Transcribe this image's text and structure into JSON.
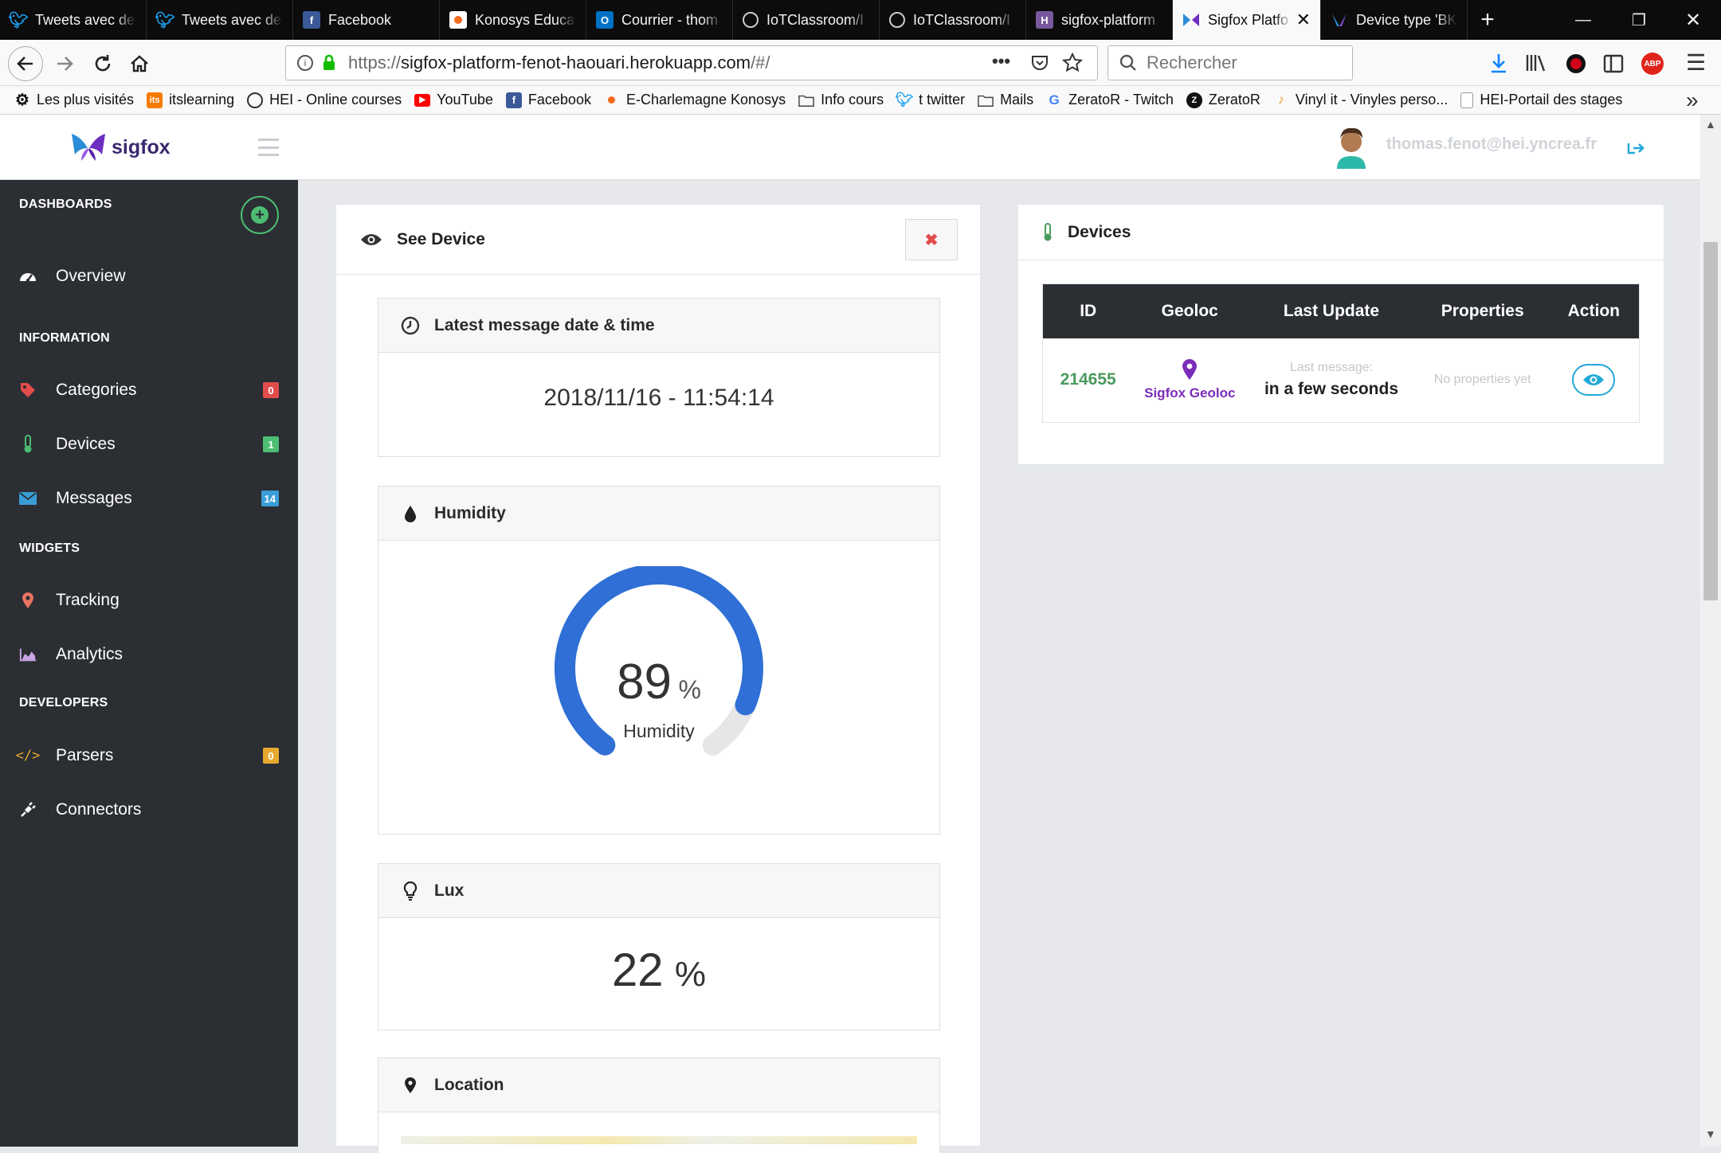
{
  "browser": {
    "tabs": [
      {
        "title": "Tweets avec de",
        "icon": "twitter-icon",
        "color": "#1da1f2"
      },
      {
        "title": "Tweets avec de",
        "icon": "twitter-icon",
        "color": "#1da1f2"
      },
      {
        "title": "Facebook",
        "icon": "facebook-icon",
        "color": "#3b5998"
      },
      {
        "title": "Konosys Educat",
        "icon": "konosys-icon",
        "color": "#f26b1d"
      },
      {
        "title": "Courrier - thom",
        "icon": "outlook-icon",
        "color": "#0072c6"
      },
      {
        "title": "IoTClassroom/I",
        "icon": "github-icon",
        "color": "#333333"
      },
      {
        "title": "IoTClassroom/I",
        "icon": "github-icon",
        "color": "#333333"
      },
      {
        "title": "sigfox-platform",
        "icon": "heroku-icon",
        "color": "#79589f"
      },
      {
        "title": "Sigfox Platfo",
        "icon": "sigfox-icon",
        "color": "#6e2dc1",
        "active": true
      },
      {
        "title": "Device type 'BK",
        "icon": "sigfox-icon",
        "color": "#6e2dc1"
      }
    ],
    "url": "https://sigfox-platform-fenot-haouari.herokuapp.com/#/",
    "url_host": "sigfox-platform-fenot-haouari.herokuapp.com",
    "url_prefix": "https://",
    "url_suffix": "/#/",
    "search_placeholder": "Rechercher",
    "bookmarks": [
      {
        "label": "Les plus visités",
        "icon": "gear-icon"
      },
      {
        "label": "itslearning",
        "icon": "itslearning-icon"
      },
      {
        "label": "HEI - Online courses",
        "icon": "globe-icon"
      },
      {
        "label": "YouTube",
        "icon": "youtube-icon"
      },
      {
        "label": "Facebook",
        "icon": "facebook-icon"
      },
      {
        "label": "E-Charlemagne Konosys",
        "icon": "konosys-icon"
      },
      {
        "label": "Info cours",
        "icon": "folder-icon"
      },
      {
        "label": "t  twitter",
        "icon": "twitter-icon"
      },
      {
        "label": "Mails",
        "icon": "folder-icon"
      },
      {
        "label": "ZeratoR - Twitch",
        "icon": "google-icon"
      },
      {
        "label": "ZeratoR",
        "icon": "zerator-icon"
      },
      {
        "label": "Vinyl it - Vinyles perso...",
        "icon": "vinyl-icon"
      },
      {
        "label": "HEI-Portail des stages",
        "icon": "page-icon"
      }
    ]
  },
  "app": {
    "brand": "sigfox",
    "user_email": "thomas.fenot@hei.yncrea.fr"
  },
  "sidebar": {
    "sections": {
      "dashboards": "DASHBOARDS",
      "information": "INFORMATION",
      "widgets": "WIDGETS",
      "developers": "DEVELOPERS"
    },
    "items": {
      "overview": "Overview",
      "categories": {
        "label": "Categories",
        "badge": "0",
        "badge_color": "#e24c4b"
      },
      "devices": {
        "label": "Devices",
        "badge": "1",
        "badge_color": "#4dbd74"
      },
      "messages": {
        "label": "Messages",
        "badge": "14",
        "badge_color": "#3a9dd8"
      },
      "tracking": "Tracking",
      "analytics": "Analytics",
      "parsers": {
        "label": "Parsers",
        "badge": "0",
        "badge_color": "#e6a82e"
      },
      "connectors": "Connectors"
    }
  },
  "see_device": {
    "title": "See Device",
    "close_icon": "times-icon",
    "latest_message": {
      "title": "Latest message date & time",
      "value": "2018/11/16 - 11:54:14"
    },
    "humidity": {
      "title": "Humidity",
      "value": "89",
      "unit": "%",
      "label": "Humidity",
      "fraction": 0.89
    },
    "lux": {
      "title": "Lux",
      "value": "22",
      "unit": "%"
    },
    "location": {
      "title": "Location"
    }
  },
  "devices_panel": {
    "title": "Devices",
    "columns": [
      "ID",
      "Geoloc",
      "Last Update",
      "Properties",
      "Action"
    ],
    "rows": [
      {
        "id": "214655",
        "geoloc": "Sigfox Geoloc",
        "last_update_caption": "Last message:",
        "last_update": "in a few seconds",
        "properties": "No properties yet"
      }
    ]
  },
  "colors": {
    "sidebar_bg": "#2b2e33",
    "gauge": "#2f6fd6",
    "id_green": "#4a9a5e",
    "geoloc_purple": "#7b2cb8",
    "action_blue": "#21a8d8",
    "close_red": "#e24c4b"
  }
}
